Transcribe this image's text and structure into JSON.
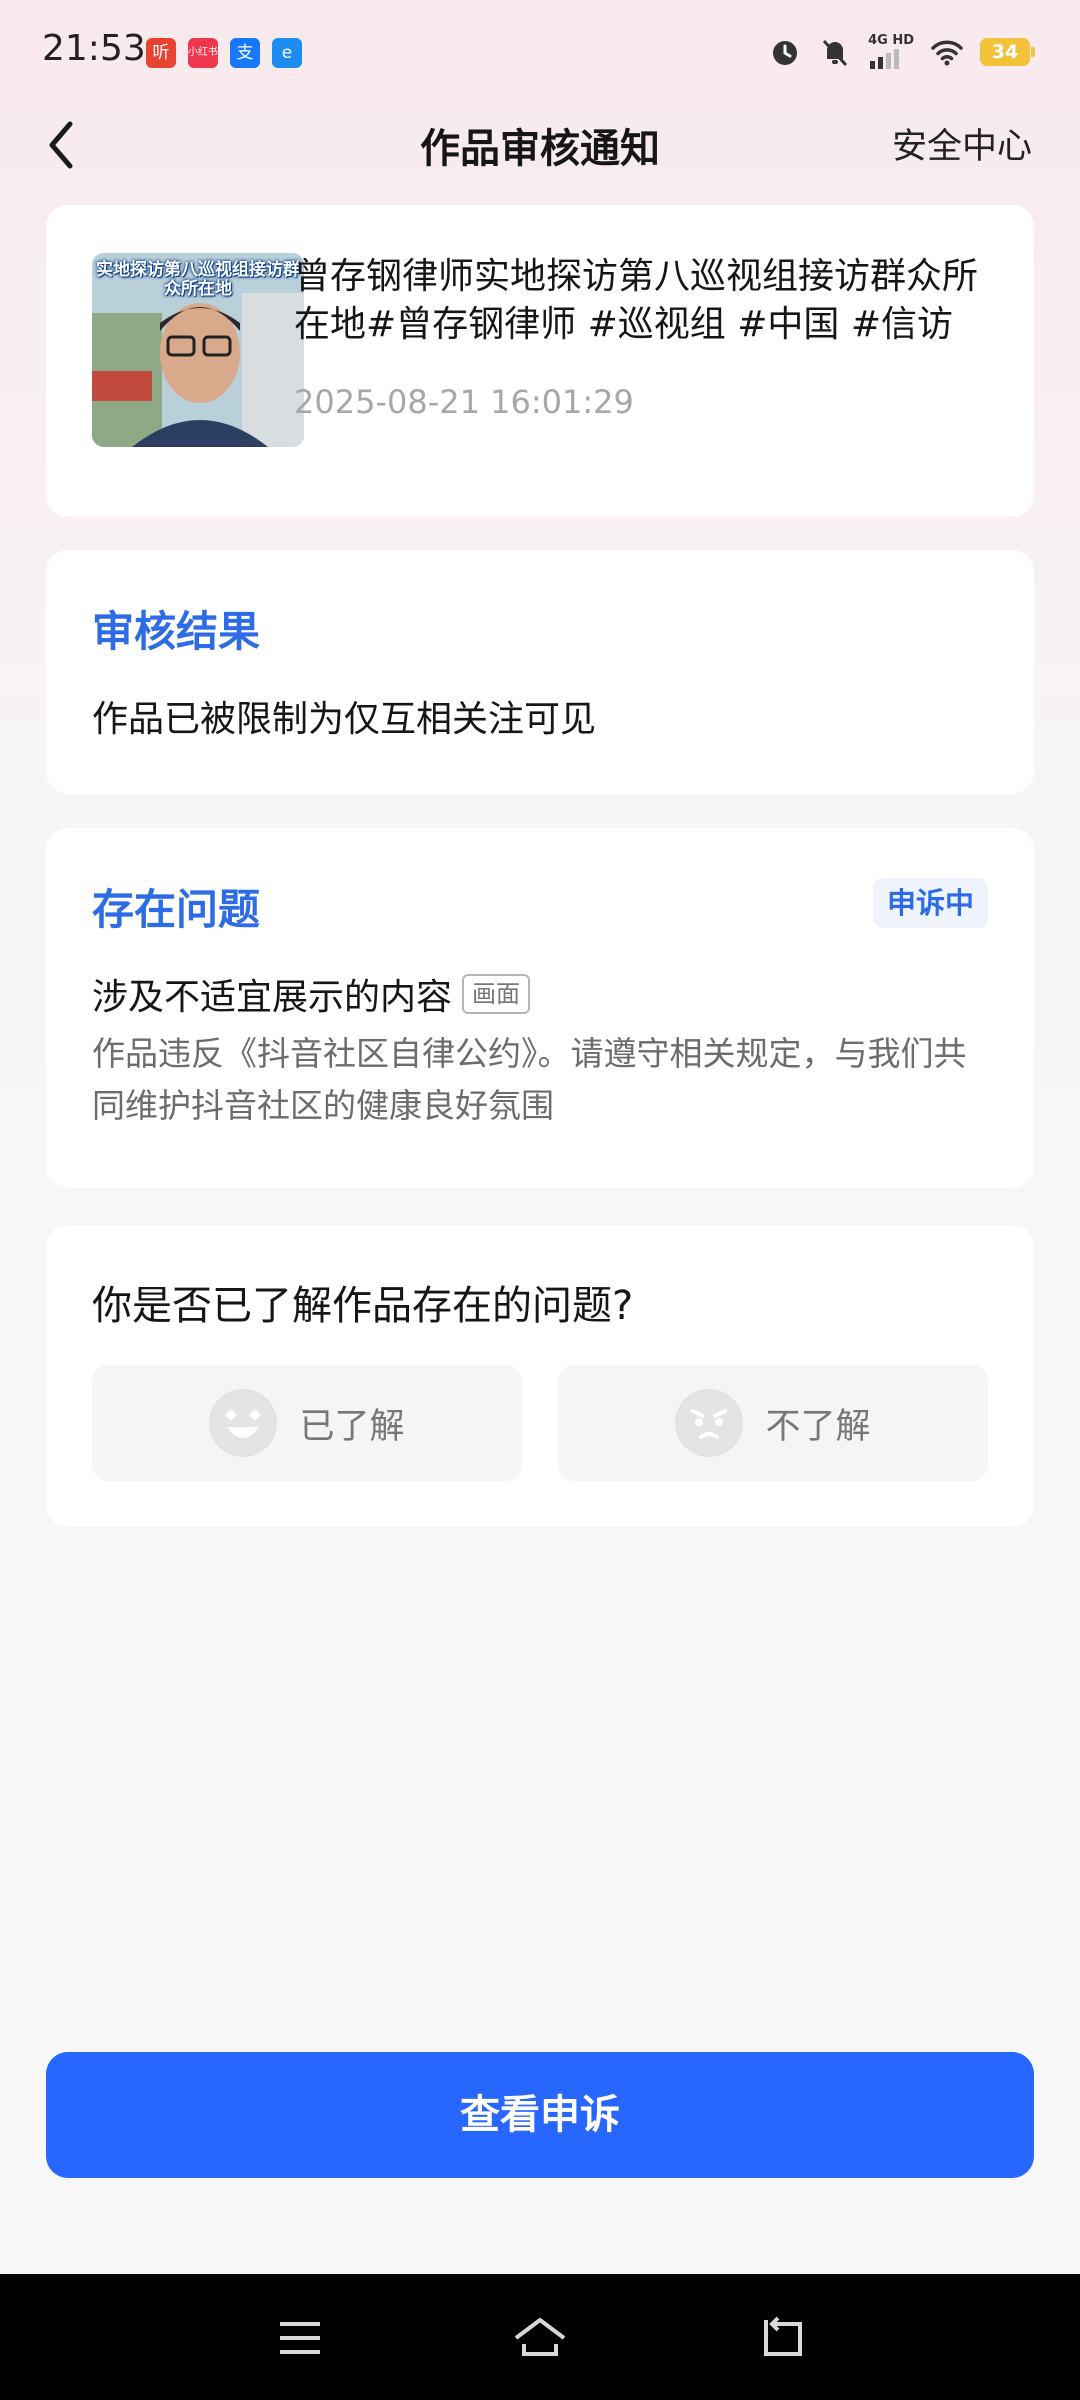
{
  "status_bar": {
    "time": "21:53",
    "apps": [
      {
        "name": "ting-app-icon",
        "glyph": "听",
        "color": "#e8432f"
      },
      {
        "name": "xiaohongshu-app-icon",
        "glyph": "小红书",
        "color": "#f0364d"
      },
      {
        "name": "alipay-app-icon",
        "glyph": "支",
        "color": "#1677ff"
      },
      {
        "name": "browser-app-icon",
        "glyph": "e",
        "color": "#1c8cf0"
      }
    ],
    "network": "4G HD",
    "battery": "34"
  },
  "header": {
    "title": "作品审核通知",
    "right_link": "安全中心"
  },
  "video": {
    "thumb_caption": "实地探访第八巡视组接访群众所在地",
    "title": "曾存钢律师实地探访第八巡视组接访群众所在地#曾存钢律师 #巡视组 #中国 #信访",
    "time": "2025-08-21 16:01:29"
  },
  "result": {
    "heading": "审核结果",
    "text": "作品已被限制为仅互相关注可见"
  },
  "problem": {
    "heading": "存在问题",
    "badge": "申诉中",
    "issue_title": "涉及不适宜展示的内容",
    "issue_tag": "画面",
    "description": "作品违反《抖音社区自律公约》。请遵守相关规定，与我们共同维护抖音社区的健康良好氛围"
  },
  "question": {
    "text": "你是否已了解作品存在的问题?",
    "yes_label": "已了解",
    "no_label": "不了解"
  },
  "action": {
    "button_label": "查看申诉"
  },
  "colors": {
    "accent": "#2e6be6",
    "primary_button": "#2767ff",
    "battery": "#f3c23c"
  }
}
